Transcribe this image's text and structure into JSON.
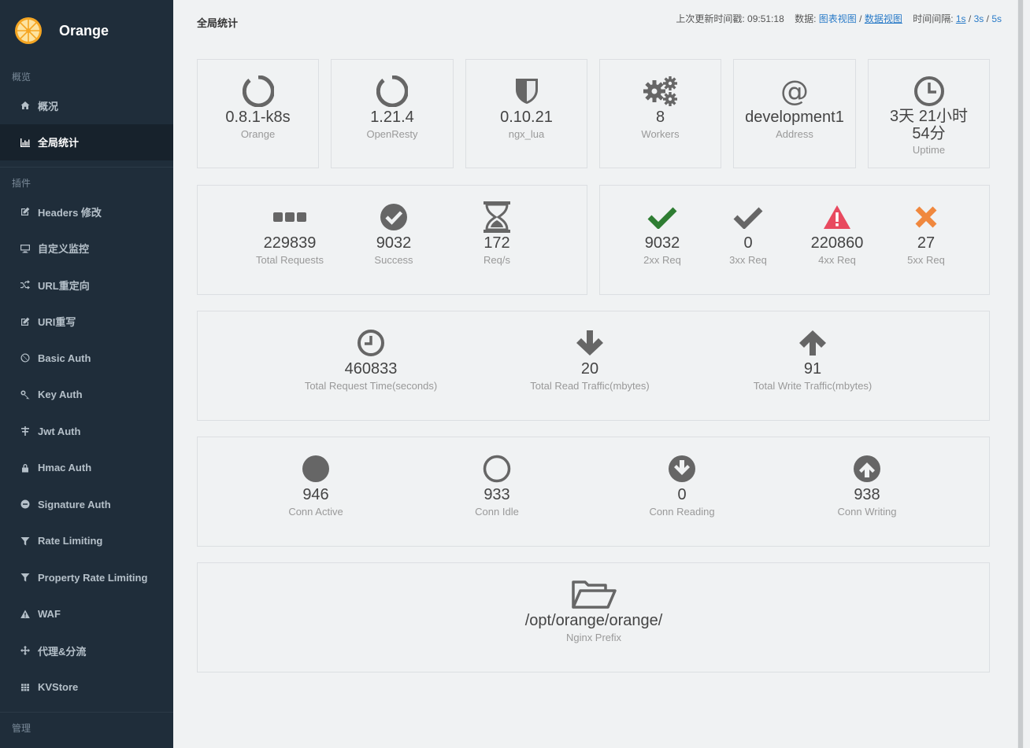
{
  "app": {
    "name": "Orange"
  },
  "sidebar": {
    "section_overview": "概览",
    "overview_items": [
      {
        "label": "概况",
        "icon": "home-icon"
      },
      {
        "label": "全局统计",
        "icon": "bar-chart-icon",
        "active": true
      }
    ],
    "section_plugins": "插件",
    "plugin_items": [
      {
        "label": "Headers 修改",
        "icon": "edit-icon"
      },
      {
        "label": "自定义监控",
        "icon": "monitor-icon"
      },
      {
        "label": "URL重定向",
        "icon": "shuffle-icon"
      },
      {
        "label": "URI重写",
        "icon": "edit-icon"
      },
      {
        "label": "Basic Auth",
        "icon": "ban-icon"
      },
      {
        "label": "Key Auth",
        "icon": "key-icon"
      },
      {
        "label": "Jwt Auth",
        "icon": "sliders-icon"
      },
      {
        "label": "Hmac Auth",
        "icon": "lock-icon"
      },
      {
        "label": "Signature Auth",
        "icon": "minus-circle-icon"
      },
      {
        "label": "Rate Limiting",
        "icon": "filter-icon"
      },
      {
        "label": "Property Rate Limiting",
        "icon": "filter-icon"
      },
      {
        "label": "WAF",
        "icon": "warning-icon"
      },
      {
        "label": "代理&分流",
        "icon": "arrows-icon"
      },
      {
        "label": "KVStore",
        "icon": "grid-icon"
      }
    ],
    "section_manage": "管理"
  },
  "header": {
    "title": "全局统计",
    "last_update_label": "上次更新时间戳:",
    "last_update_value": "09:51:18",
    "data_label": "数据:",
    "chart_view": "图表视图",
    "sep1": "/",
    "data_view": "数据视图",
    "interval_label": "时间间隔:",
    "interval_1s": "1s",
    "sep2": "/",
    "interval_3s": "3s",
    "sep3": "/",
    "interval_5s": "5s"
  },
  "info": [
    {
      "value": "0.8.1-k8s",
      "label": "Orange",
      "icon": "circle-notch-icon"
    },
    {
      "value": "1.21.4",
      "label": "OpenResty",
      "icon": "circle-notch-icon"
    },
    {
      "value": "0.10.21",
      "label": "ngx_lua",
      "icon": "shield-icon"
    },
    {
      "value": "8",
      "label": "Workers",
      "icon": "gears-icon"
    },
    {
      "value": "development1",
      "label": "Address",
      "icon": "at-icon"
    },
    {
      "value": "3天 21小时 54分",
      "label": "Uptime",
      "icon": "clock-icon"
    }
  ],
  "requests": [
    {
      "value": "229839",
      "label": "Total Requests",
      "icon": "ellipsis-icon"
    },
    {
      "value": "9032",
      "label": "Success",
      "icon": "check-circle-icon"
    },
    {
      "value": "172",
      "label": "Req/s",
      "icon": "hourglass-icon"
    }
  ],
  "status_codes": [
    {
      "value": "9032",
      "label": "2xx Req",
      "icon": "check-icon",
      "color": "#2e7d32"
    },
    {
      "value": "0",
      "label": "3xx Req",
      "icon": "check-icon",
      "color": "#666666"
    },
    {
      "value": "220860",
      "label": "4xx Req",
      "icon": "warning-icon",
      "color": "#e84a5f"
    },
    {
      "value": "27",
      "label": "5xx Req",
      "icon": "times-icon",
      "color": "#f0883e"
    }
  ],
  "traffic": [
    {
      "value": "460833",
      "label": "Total Request Time(seconds)",
      "icon": "clock-icon"
    },
    {
      "value": "20",
      "label": "Total Read Traffic(mbytes)",
      "icon": "arrow-down-icon"
    },
    {
      "value": "91",
      "label": "Total Write Traffic(mbytes)",
      "icon": "arrow-up-icon"
    }
  ],
  "connections": [
    {
      "value": "946",
      "label": "Conn Active",
      "icon": "filled-circle-icon"
    },
    {
      "value": "933",
      "label": "Conn Idle",
      "icon": "empty-circle-icon"
    },
    {
      "value": "0",
      "label": "Conn Reading",
      "icon": "arrow-circle-down-icon"
    },
    {
      "value": "938",
      "label": "Conn Writing",
      "icon": "arrow-circle-up-icon"
    }
  ],
  "prefix": {
    "value": "/opt/orange/orange/",
    "label": "Nginx Prefix",
    "icon": "folder-open-icon"
  }
}
